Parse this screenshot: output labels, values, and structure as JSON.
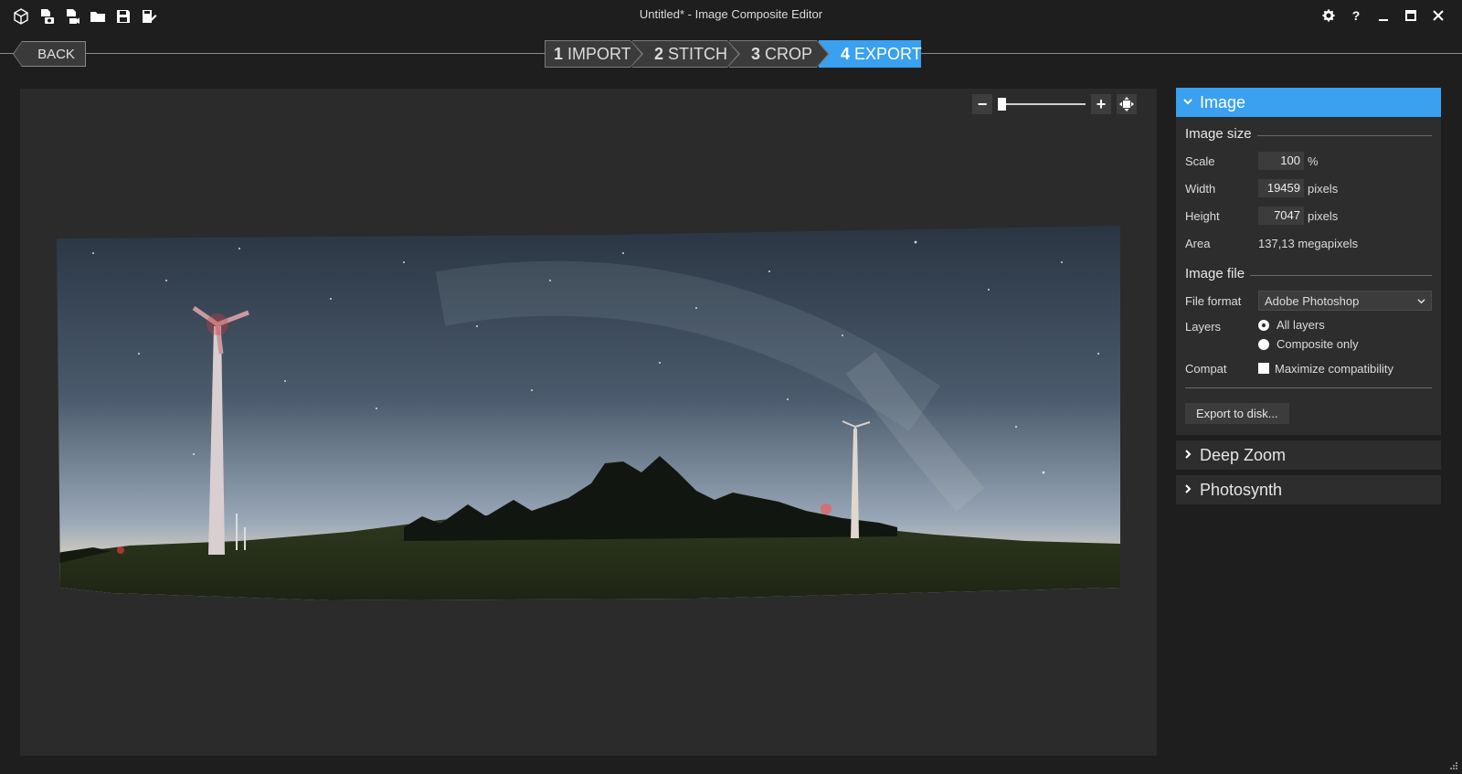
{
  "window": {
    "title": "Untitled* - Image Composite Editor",
    "toolbar_icons": [
      "new-project-icon",
      "new-panorama-from-images-icon",
      "new-panorama-from-video-icon",
      "open-icon",
      "save-icon",
      "save-as-icon"
    ],
    "controls": [
      "gear-icon",
      "help-icon",
      "minimize-icon",
      "maximize-icon",
      "close-icon"
    ],
    "help_label": "?"
  },
  "nav": {
    "back_label": "BACK",
    "steps": [
      {
        "num": "1",
        "label": "IMPORT"
      },
      {
        "num": "2",
        "label": "STITCH"
      },
      {
        "num": "3",
        "label": "CROP"
      },
      {
        "num": "4",
        "label": "EXPORT"
      }
    ],
    "active_step": 4
  },
  "zoom": {
    "minus": "−",
    "plus": "+",
    "level": 0.0
  },
  "panel": {
    "image": {
      "title": "Image",
      "size_heading": "Image size",
      "scale_label": "Scale",
      "scale_value": "100",
      "scale_unit": "%",
      "width_label": "Width",
      "width_value": "19459",
      "width_unit": "pixels",
      "height_label": "Height",
      "height_value": "7047",
      "height_unit": "pixels",
      "area_label": "Area",
      "area_value": "137,13 megapixels",
      "file_heading": "Image file",
      "format_label": "File format",
      "format_value": "Adobe Photoshop",
      "layers_label": "Layers",
      "layers_all": "All layers",
      "layers_composite": "Composite only",
      "compat_label": "Compat",
      "compat_check": "Maximize compatibility",
      "export_button": "Export to disk..."
    },
    "deep_zoom": {
      "title": "Deep Zoom"
    },
    "photosynth": {
      "title": "Photosynth"
    }
  },
  "colors": {
    "accent": "#3aa0f0",
    "background": "#1e1e1e",
    "canvas": "#2b2b2b",
    "panel": "#2d2d2d"
  }
}
